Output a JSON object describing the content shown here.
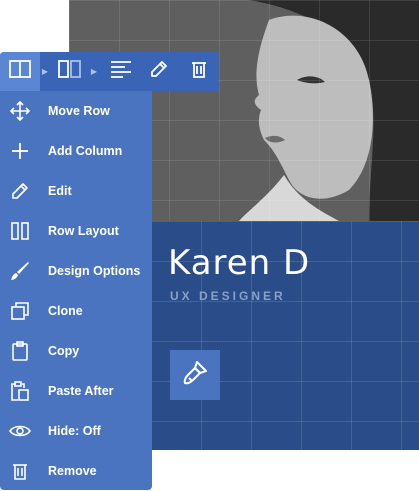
{
  "card": {
    "name": "Karen D",
    "subtitle": "UX DESIGNER"
  },
  "toolbar": {
    "items": [
      {
        "icon": "row-icon"
      },
      {
        "icon": "column-icon"
      },
      {
        "icon": "align-left-icon"
      },
      {
        "icon": "pencil-icon"
      },
      {
        "icon": "trash-icon"
      }
    ]
  },
  "menu": {
    "items": [
      {
        "label": "Move Row",
        "icon": "move-icon"
      },
      {
        "label": "Add Column",
        "icon": "plus-icon"
      },
      {
        "label": "Edit",
        "icon": "pencil-icon"
      },
      {
        "label": "Row Layout",
        "icon": "columns-icon"
      },
      {
        "label": "Design Options",
        "icon": "brush-icon"
      },
      {
        "label": "Clone",
        "icon": "clone-icon"
      },
      {
        "label": "Copy",
        "icon": "clipboard-icon"
      },
      {
        "label": "Paste After",
        "icon": "paste-icon"
      },
      {
        "label": "Hide: Off",
        "icon": "eye-icon"
      },
      {
        "label": "Remove",
        "icon": "trash-icon"
      }
    ]
  },
  "colors": {
    "menu_bg": "#4a74c0",
    "toolbar_bg": "#3a65b6",
    "panel_bg": "#2a4c88"
  }
}
